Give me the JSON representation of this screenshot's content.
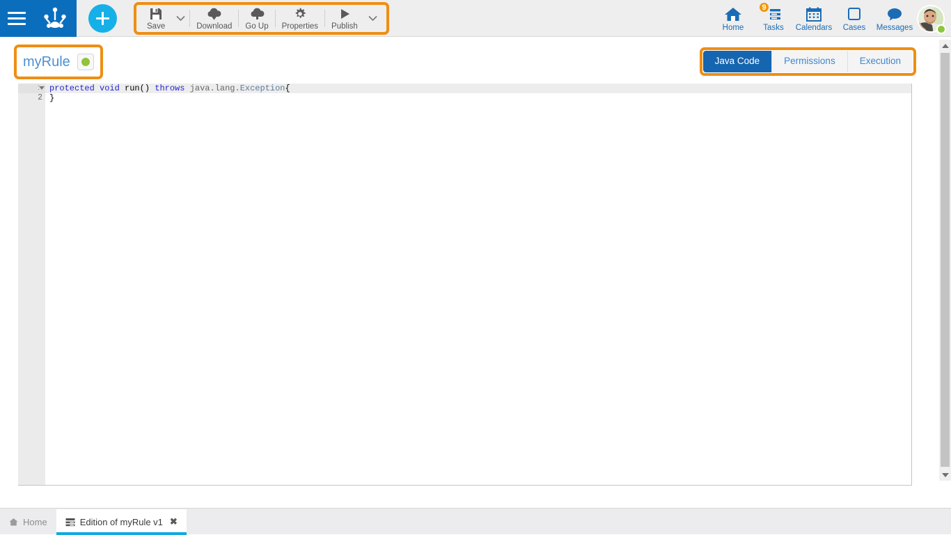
{
  "app": {
    "accent_blue": "#0a6ebd",
    "highlight_orange": "#ef8e13",
    "cyan": "#16b0e8"
  },
  "header": {
    "menu_icon": "hamburger-icon",
    "logo_icon": "frog-foot-logo",
    "add_button_label": "+"
  },
  "toolbar": {
    "items": [
      {
        "label": "Save",
        "icon": "floppy-disk-icon",
        "caret": true
      },
      {
        "label": "Download",
        "icon": "cloud-download-icon",
        "caret": false
      },
      {
        "label": "Go Up",
        "icon": "cloud-upload-icon",
        "caret": false
      },
      {
        "label": "Properties",
        "icon": "gear-icon",
        "caret": false
      },
      {
        "label": "Publish",
        "icon": "play-triangle-icon",
        "caret": true
      }
    ]
  },
  "topnav": {
    "items": [
      {
        "label": "Home",
        "icon": "house-icon",
        "badge": ""
      },
      {
        "label": "Tasks",
        "icon": "tasks-list-icon",
        "badge": "9"
      },
      {
        "label": "Calendars",
        "icon": "calendar-icon",
        "badge": ""
      },
      {
        "label": "Cases",
        "icon": "square-case-icon",
        "badge": ""
      },
      {
        "label": "Messages",
        "icon": "speech-bubble-icon",
        "badge": ""
      }
    ],
    "avatar": {
      "icon": "user-avatar",
      "status": "online",
      "status_color": "#8cc63e"
    }
  },
  "page": {
    "title": "myRule",
    "status_color": "#93c23c",
    "tabs": [
      {
        "label": "Java Code",
        "active": true
      },
      {
        "label": "Permissions",
        "active": false
      },
      {
        "label": "Execution",
        "active": false
      }
    ]
  },
  "editor": {
    "lines": [
      {
        "number": "1",
        "foldable": true,
        "current": true,
        "tokens": [
          {
            "t": "protected",
            "c": "kw"
          },
          {
            "t": " ",
            "c": ""
          },
          {
            "t": "void",
            "c": "kw"
          },
          {
            "t": " run() ",
            "c": ""
          },
          {
            "t": "throws",
            "c": "kw"
          },
          {
            "t": " ",
            "c": ""
          },
          {
            "t": "java.lang.",
            "c": "ns"
          },
          {
            "t": "Exception",
            "c": "typ"
          },
          {
            "t": "{",
            "c": ""
          }
        ]
      },
      {
        "number": "2",
        "foldable": false,
        "current": false,
        "tokens": [
          {
            "t": "}",
            "c": ""
          }
        ]
      }
    ],
    "scrollbar": {
      "up_icon": "scroll-up-arrow-icon",
      "down_icon": "scroll-down-arrow-icon"
    }
  },
  "taskbar": {
    "tabs": [
      {
        "label": "Home",
        "icon": "house-icon",
        "active": false,
        "closable": false
      },
      {
        "label": "Edition of myRule v1",
        "icon": "window-list-icon",
        "active": true,
        "closable": true,
        "close_glyph": "✖"
      }
    ]
  }
}
